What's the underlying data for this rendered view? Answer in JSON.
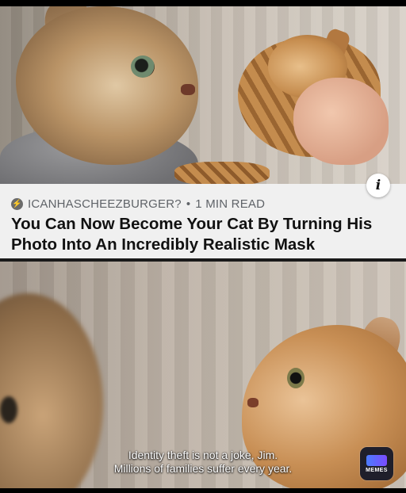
{
  "article": {
    "source": "ICANHASCHEEZBURGER?",
    "separator": "•",
    "read_time": "1 MIN READ",
    "headline": "You Can Now Become Your Cat By Turning His Photo Into An Incredibly Realistic Mask",
    "info_icon": "i"
  },
  "caption": {
    "line1": "Identity theft is not a joke, Jim.",
    "line2": "Millions of families suffer every year."
  },
  "watermark": {
    "label": "MEMES"
  },
  "colors": {
    "card_background": "#f0f0f0",
    "meta_text": "#5f6368",
    "headline_text": "#111111"
  }
}
